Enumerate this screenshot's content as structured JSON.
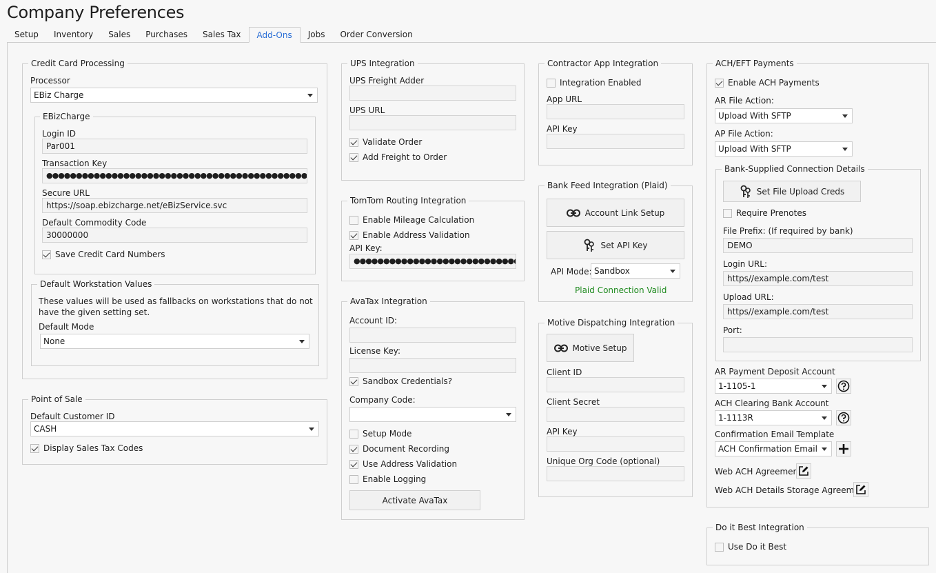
{
  "window_title": "Company Preferences",
  "tabs": [
    "Setup",
    "Inventory",
    "Sales",
    "Purchases",
    "Sales Tax",
    "Add-Ons",
    "Jobs",
    "Order Conversion"
  ],
  "active_tab": "Add-Ons",
  "credit_card": {
    "title": "Credit Card Processing",
    "processor_label": "Processor",
    "processor_value": "EBiz Charge",
    "ebiz": {
      "title": "EBizCharge",
      "login_label": "Login ID",
      "login_value": "Par001",
      "txkey_label": "Transaction Key",
      "txkey_value": "●●●●●●●●●●●●●●●●●●●●●●●●●●●●●●●●●●●●●●●●●●●●●●●●",
      "url_label": "Secure URL",
      "url_value": "https://soap.ebizcharge.net/eBizService.svc",
      "commodity_label": "Default Commodity Code",
      "commodity_value": "30000000",
      "save_cc_label": "Save Credit Card Numbers"
    },
    "workstation": {
      "title": "Default Workstation Values",
      "note": "These values will be used as fallbacks on workstations that do not have the given setting set.",
      "mode_label": "Default Mode",
      "mode_value": "None"
    }
  },
  "pos": {
    "title": "Point of Sale",
    "customer_label": "Default Customer ID",
    "customer_value": "CASH",
    "tax_codes_label": "Display Sales Tax Codes"
  },
  "ups": {
    "title": "UPS Integration",
    "freight_label": "UPS Freight Adder",
    "freight_value": "",
    "url_label": "UPS URL",
    "url_value": "",
    "validate_label": "Validate Order",
    "add_freight_label": "Add Freight to Order"
  },
  "tomtom": {
    "title": "TomTom Routing Integration",
    "mileage_label": "Enable Mileage Calculation",
    "address_label": "Enable Address Validation",
    "api_label": "API Key:",
    "api_value": "●●●●●●●●●●●●●●●●●●●●●●●●●●●●●●●●●●●●●●●●"
  },
  "avatax": {
    "title": "AvaTax Integration",
    "account_label": "Account ID:",
    "account_value": "",
    "license_label": "License Key:",
    "license_value": "",
    "sandbox_label": "Sandbox Credentials?",
    "company_label": "Company Code:",
    "company_value": "",
    "setup_label": "Setup Mode",
    "doc_label": "Document Recording",
    "addr_label": "Use Address Validation",
    "log_label": "Enable Logging",
    "activate_label": "Activate AvaTax"
  },
  "contractor": {
    "title": "Contractor App Integration",
    "enabled_label": "Integration Enabled",
    "url_label": "App URL",
    "url_value": "",
    "api_label": "API Key",
    "api_value": ""
  },
  "plaid": {
    "title": "Bank Feed Integration (Plaid)",
    "link_label": "Account Link Setup",
    "api_label": "Set API Key",
    "mode_label": "API Mode:",
    "mode_value": "Sandbox",
    "status": "Plaid Connection Valid"
  },
  "motive": {
    "title": "Motive Dispatching Integration",
    "setup_label": "Motive Setup",
    "client_id_label": "Client ID",
    "client_id_value": "",
    "secret_label": "Client Secret",
    "secret_value": "",
    "api_label": "API Key",
    "api_value": "",
    "org_label": "Unique Org Code (optional)",
    "org_value": ""
  },
  "ach": {
    "title": "ACH/EFT Payments",
    "enable_label": "Enable ACH Payments",
    "ar_action_label": "AR File Action:",
    "ar_action_value": "Upload With SFTP",
    "ap_action_label": "AP File Action:",
    "ap_action_value": "Upload With SFTP",
    "bank": {
      "title": "Bank-Supplied Connection Details",
      "creds_label": "Set File Upload Creds",
      "prenotes_label": "Require Prenotes",
      "prefix_label": "File Prefix: (If required by bank)",
      "prefix_value": "DEMO",
      "login_label": "Login URL:",
      "login_value": "https//example.com/test",
      "upload_label": "Upload URL:",
      "upload_value": "https//example.com/test",
      "port_label": "Port:",
      "port_value": ""
    },
    "deposit_label": "AR Payment Deposit Account",
    "deposit_value": "1-1105-1",
    "clearing_label": "ACH Clearing Bank Account",
    "clearing_value": "1-1113R",
    "email_label": "Confirmation Email Template",
    "email_value": "ACH Confirmation Email",
    "web_agreement_label": "Web ACH Agreement",
    "web_storage_label": "Web ACH Details Storage Agreement"
  },
  "doitbest": {
    "title": "Do it Best Integration",
    "use_label": "Use Do it Best"
  }
}
